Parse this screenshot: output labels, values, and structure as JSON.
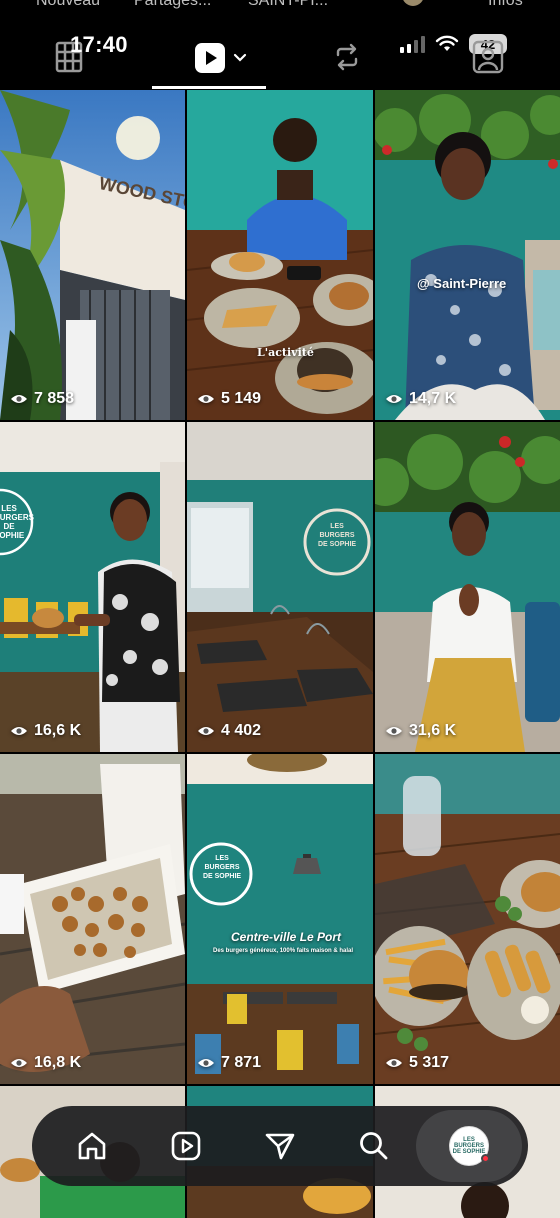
{
  "header": {
    "time": "17:40",
    "battery": "42",
    "ghost_tabs": [
      "Nouveau",
      "Partages...",
      "SAINT-PI...",
      "Infos"
    ]
  },
  "grid": {
    "tiles": [
      {
        "views": "7 858",
        "caption": "",
        "sign": "WOOD STOCK"
      },
      {
        "views": "5 149",
        "caption": "L'activité"
      },
      {
        "views": "14,7 K",
        "caption": "@ Saint-Pierre"
      },
      {
        "views": "16,6 K",
        "caption": "",
        "sign": "LES BURGERS DE SOPHIE"
      },
      {
        "views": "4 402",
        "caption": "",
        "sign": "LES BURGERS DE SOPHIE"
      },
      {
        "views": "31,6 K",
        "caption": ""
      },
      {
        "views": "16,8 K",
        "caption": ""
      },
      {
        "views": "7 871",
        "caption": "Centre-ville Le Port",
        "subcaption": "Des burgers généreux, 100% faits maison & halal",
        "sign": "LES BURGERS DE SOPHIE"
      },
      {
        "views": "5 317",
        "caption": ""
      }
    ]
  },
  "bottom_nav": {
    "items": [
      "home-icon",
      "reels-icon",
      "send-icon",
      "search-icon",
      "profile-avatar"
    ],
    "profile_label": "LES BURGERS DE SOPHIE"
  },
  "colors": {
    "teal_wall": "#1f8a84",
    "wood": "#6b3d22",
    "background": "#000000"
  }
}
